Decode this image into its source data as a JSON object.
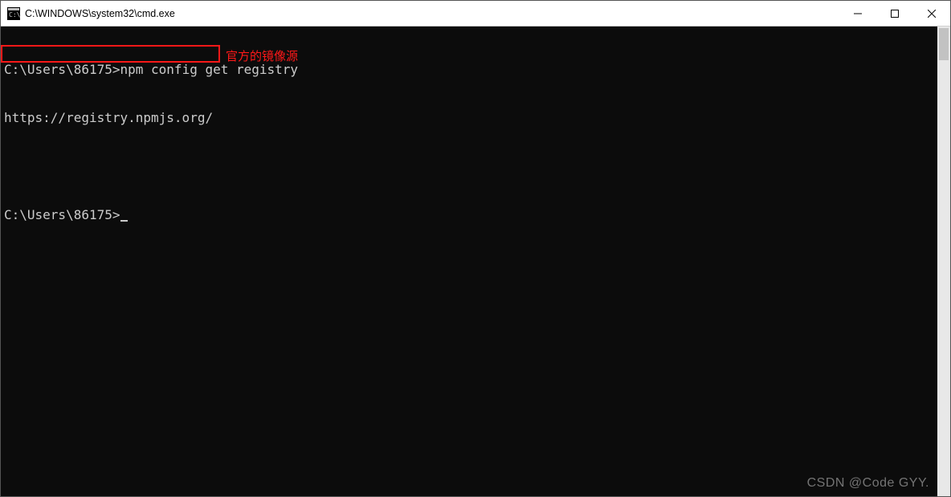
{
  "window": {
    "title": "C:\\WINDOWS\\system32\\cmd.exe"
  },
  "terminal": {
    "lines": {
      "prompt1": "C:\\Users\\86175>",
      "command1": "npm config get registry",
      "output1": "https://registry.npmjs.org/",
      "prompt2": "C:\\Users\\86175>"
    }
  },
  "annotation": {
    "label": "官方的镜像源"
  },
  "watermark": "CSDN @Code GYY."
}
